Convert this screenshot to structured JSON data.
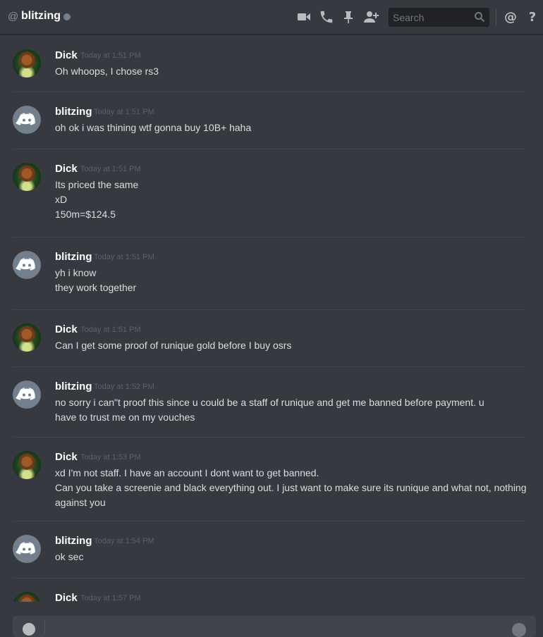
{
  "header": {
    "at_symbol": "@",
    "channel_name": "blitzing",
    "status_color": "#747f8d",
    "search_placeholder": "Search",
    "icons": [
      "video-icon",
      "phone-icon",
      "pin-icon",
      "add-friend-icon",
      "search-icon",
      "mention-icon",
      "help-icon"
    ]
  },
  "messages": [
    {
      "author": "Dick",
      "timestamp": "Today at 1:51 PM",
      "avatar": "photo",
      "lines": [
        "Oh whoops, I chose rs3"
      ]
    },
    {
      "author": "blitzing",
      "timestamp": "Today at 1:51 PM",
      "avatar": "discord",
      "lines": [
        "oh ok i was thining wtf gonna buy 10B+ haha"
      ]
    },
    {
      "author": "Dick",
      "timestamp": "Today at 1:51 PM",
      "avatar": "photo",
      "lines": [
        "Its priced the same",
        "xD",
        "150m=$124.5"
      ]
    },
    {
      "author": "blitzing",
      "timestamp": "Today at 1:51 PM",
      "avatar": "discord",
      "lines": [
        "yh i know",
        "they work together"
      ]
    },
    {
      "author": "Dick",
      "timestamp": "Today at 1:51 PM",
      "avatar": "photo",
      "lines": [
        "Can I get some proof of runique gold before I buy osrs"
      ]
    },
    {
      "author": "blitzing",
      "timestamp": "Today at 1:52 PM",
      "avatar": "discord",
      "lines": [
        "no sorry i can\"t proof this since u could be a staff of runique and get me banned before payment. u",
        "have to trust me on my vouches"
      ]
    },
    {
      "author": "Dick",
      "timestamp": "Today at 1:53 PM",
      "avatar": "photo",
      "lines": [
        "xd I'm not staff. I have an account I dont want to get banned.",
        "Can you take a screenie and black everything out. I just want to make sure its runique and what not, nothing",
        "against you"
      ]
    },
    {
      "author": "blitzing",
      "timestamp": "Today at 1:54 PM",
      "avatar": "discord",
      "lines": [
        "ok sec"
      ]
    },
    {
      "author": "Dick",
      "timestamp": "Today at 1:57 PM",
      "avatar": "photo",
      "lines": []
    }
  ]
}
